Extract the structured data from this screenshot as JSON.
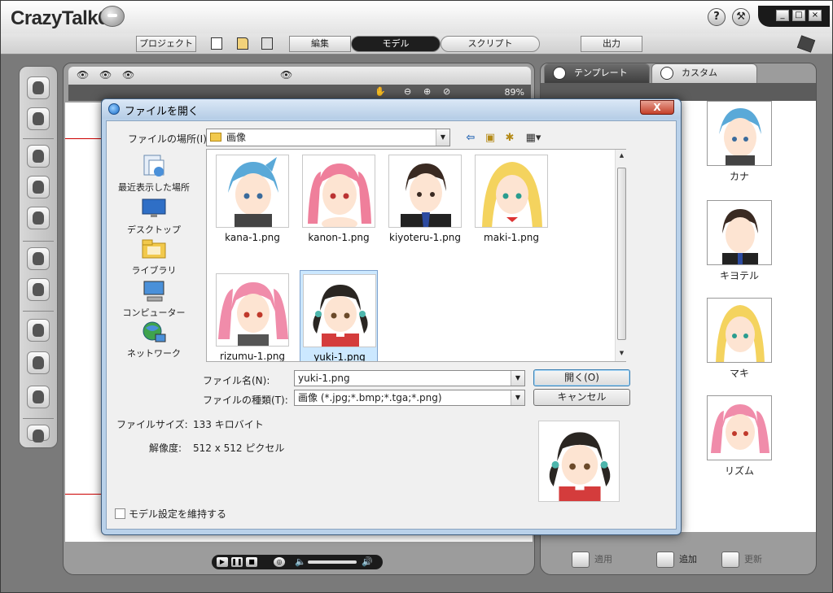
{
  "app": {
    "title": "CrazyTalk6",
    "help_label": "?",
    "menus": {
      "project": "プロジェクト",
      "edit": "編集",
      "model": "モデル",
      "script": "スクリプト",
      "output": "出力"
    },
    "zoom": "89%"
  },
  "right_panel": {
    "tabs": [
      "テンプレート",
      "カスタム"
    ],
    "templates": [
      "カナ",
      "キヨテル",
      "マキ",
      "リズム"
    ],
    "actions": {
      "apply": "適用",
      "add": "追加",
      "update": "更新"
    }
  },
  "dialog": {
    "title": "ファイルを開く",
    "close_label": "X",
    "lookin_label": "ファイルの場所(I):",
    "lookin_value": "画像",
    "places": [
      "最近表示した場所",
      "デスクトップ",
      "ライブラリ",
      "コンピューター",
      "ネットワーク"
    ],
    "files": [
      "kana-1.png",
      "kanon-1.png",
      "kiyoteru-1.png",
      "maki-1.png",
      "rizumu-1.png",
      "yuki-1.png"
    ],
    "filename_label": "ファイル名(N):",
    "filename_value": "yuki-1.png",
    "filetype_label": "ファイルの種類(T):",
    "filetype_value": "画像 (*.jpg;*.bmp;*.tga;*.png)",
    "open_button": "開く(O)",
    "cancel_button": "キャンセル",
    "filesize_label": "ファイルサイズ:",
    "filesize_value": "133 キロバイト",
    "resolution_label": "解像度:",
    "resolution_value": "512 x 512 ピクセル",
    "keep_model_label": "モデル設定を維持する"
  },
  "colors": {
    "accent": "#1d5fb0",
    "selection": "#cce8ff",
    "close_red": "#c4402a"
  }
}
